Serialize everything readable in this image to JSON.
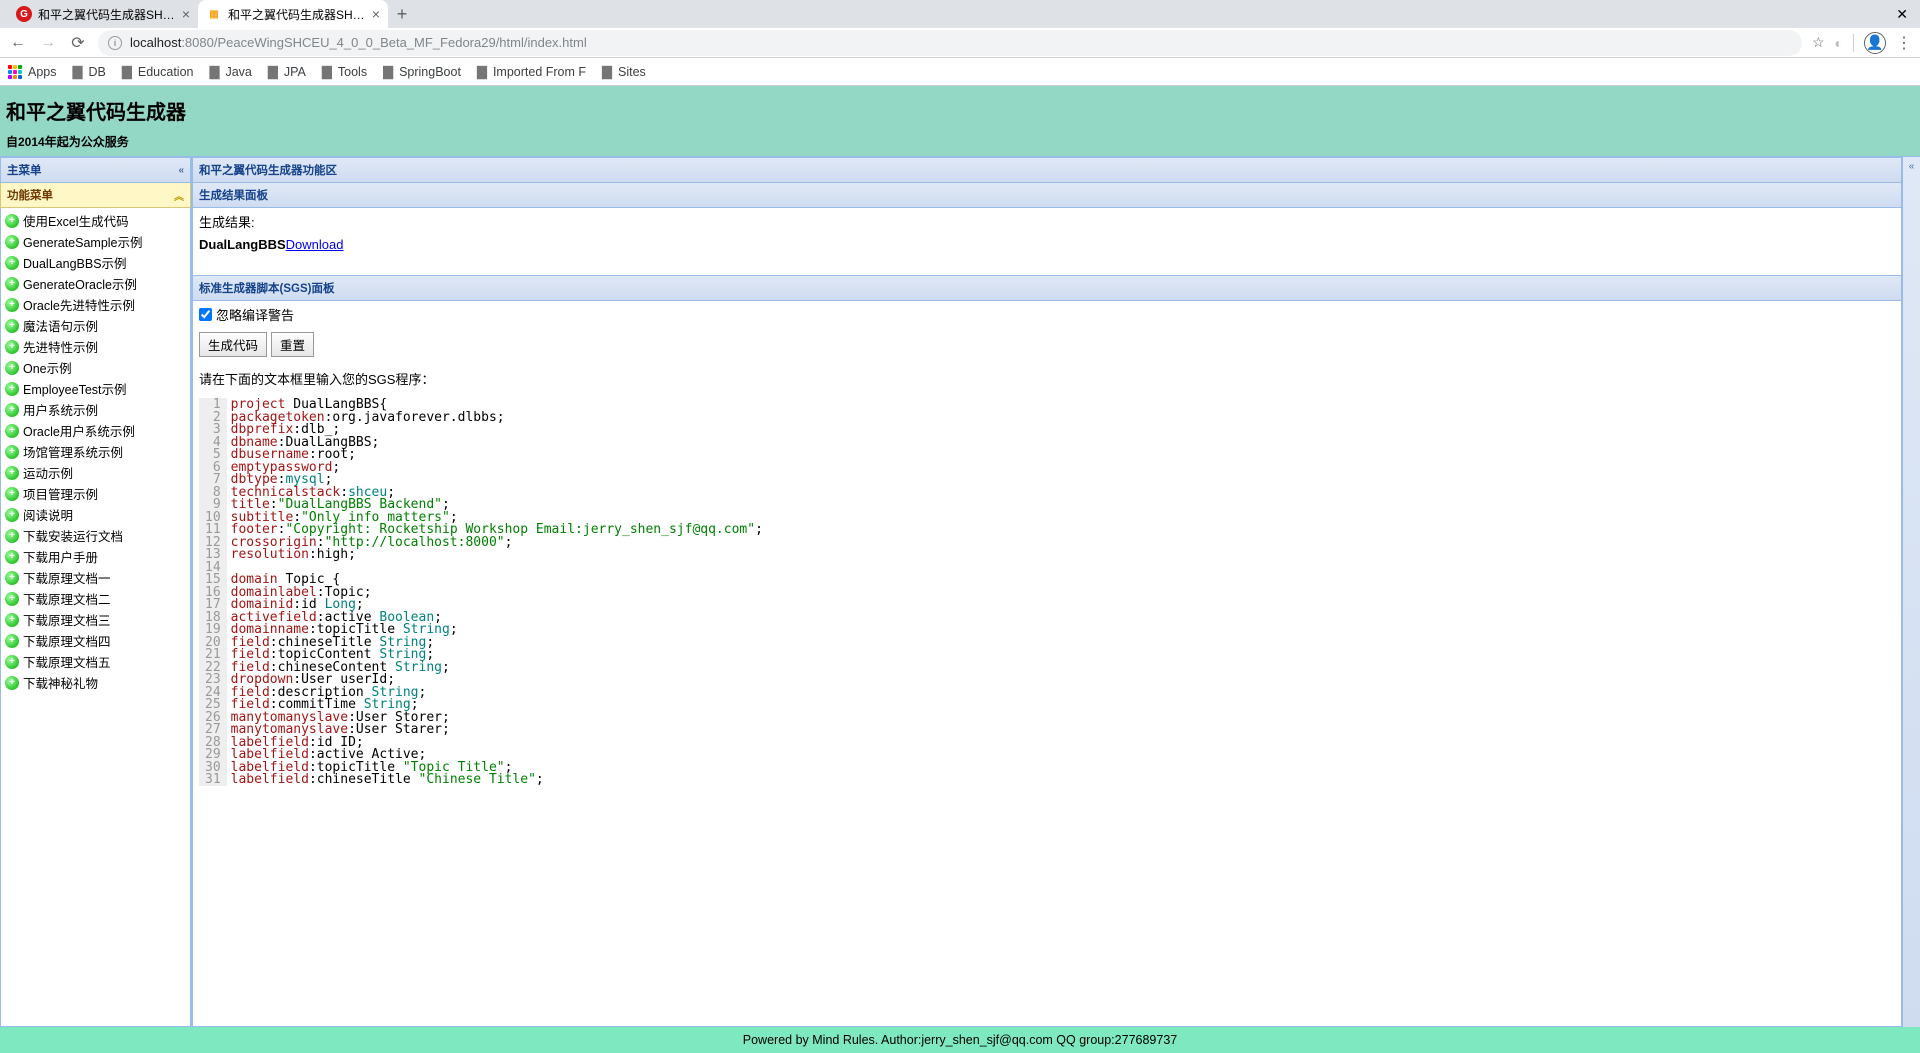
{
  "browser": {
    "tabs": [
      {
        "title": "和平之翼代码生成器SHCE...",
        "fav": {
          "text": "G",
          "bg": "#d7191c",
          "fg": "#fff"
        }
      },
      {
        "title": "和平之翼代码生成器SHCE...",
        "fav": {
          "text": "▦",
          "bg": "#fff",
          "fg": "#f5a623"
        }
      }
    ],
    "url_host": "localhost",
    "url_port": ":8080",
    "url_path": "/PeaceWingSHCEU_4_0_0_Beta_MF_Fedora29/html/index.html",
    "bookmarks": [
      "Apps",
      "DB",
      "Education",
      "Java",
      "JPA",
      "Tools",
      "SpringBoot",
      "Imported From F",
      "Sites"
    ]
  },
  "app": {
    "title": "和平之翼代码生成器",
    "subtitle": "自2014年起为公众服务",
    "footer": "Powered by Mind Rules. Author:jerry_shen_sjf@qq.com QQ group:277689737"
  },
  "left": {
    "main_menu": "主菜单",
    "fn_menu": "功能菜单",
    "items": [
      "使用Excel生成代码",
      "GenerateSample示例",
      "DualLangBBS示例",
      "GenerateOracle示例",
      "Oracle先进特性示例",
      "魔法语句示例",
      "先进特性示例",
      "One示例",
      "EmployeeTest示例",
      "用户系统示例",
      "Oracle用户系统示例",
      "场馆管理系统示例",
      "运动示例",
      "项目管理示例",
      "阅读说明",
      "下载安装运行文档",
      "下载用户手册",
      "下载原理文档一",
      "下载原理文档二",
      "下载原理文档三",
      "下载原理文档四",
      "下载原理文档五",
      "下载神秘礼物"
    ]
  },
  "center": {
    "region_title": "和平之翼代码生成器功能区",
    "result_panel": "生成结果面板",
    "result_label": "生成结果:",
    "result_name": "DualLangBBS",
    "result_link": "Download",
    "sgs_panel": "标准生成器脚本(SGS)面板",
    "chk_label": "忽略编译警告",
    "btn_gen": "生成代码",
    "btn_reset": "重置",
    "instruction": "请在下面的文本框里输入您的SGS程序："
  },
  "code": [
    [
      [
        "kw",
        "project"
      ],
      [
        "",
        " DualLangBBS{"
      ]
    ],
    [
      [
        "kw",
        "packagetoken"
      ],
      [
        "",
        ":org.javaforever.dlbbs;"
      ]
    ],
    [
      [
        "kw",
        "dbprefix"
      ],
      [
        "",
        ":dlb_;"
      ]
    ],
    [
      [
        "kw",
        "dbname"
      ],
      [
        "",
        ":DualLangBBS;"
      ]
    ],
    [
      [
        "kw",
        "dbusername"
      ],
      [
        "",
        ":root;"
      ]
    ],
    [
      [
        "kw",
        "emptypassword"
      ],
      [
        "",
        ";"
      ]
    ],
    [
      [
        "kw",
        "dbtype"
      ],
      [
        "",
        ":"
      ],
      [
        "ty",
        "mysql"
      ],
      [
        "",
        ";"
      ]
    ],
    [
      [
        "kw",
        "technicalstack"
      ],
      [
        "",
        ":"
      ],
      [
        "ty",
        "shceu"
      ],
      [
        "",
        ";"
      ]
    ],
    [
      [
        "kw",
        "title"
      ],
      [
        "",
        ":"
      ],
      [
        "st",
        "\"DualLangBBS Backend\""
      ],
      [
        "",
        ";"
      ]
    ],
    [
      [
        "kw",
        "subtitle"
      ],
      [
        "",
        ":"
      ],
      [
        "st",
        "\"Only info matters\""
      ],
      [
        "",
        ";"
      ]
    ],
    [
      [
        "kw",
        "footer"
      ],
      [
        "",
        ":"
      ],
      [
        "st",
        "\"Copyright: Rocketship Workshop Email:jerry_shen_sjf@qq.com\""
      ],
      [
        "",
        ";"
      ]
    ],
    [
      [
        "kw",
        "crossorigin"
      ],
      [
        "",
        ":"
      ],
      [
        "st",
        "\"http://localhost:8000\""
      ],
      [
        "",
        ";"
      ]
    ],
    [
      [
        "kw",
        "resolution"
      ],
      [
        "",
        ":high;"
      ]
    ],
    [
      [
        "",
        "  "
      ]
    ],
    [
      [
        "kw",
        "domain"
      ],
      [
        "",
        " Topic {"
      ]
    ],
    [
      [
        "kw",
        "domainlabel"
      ],
      [
        "",
        ":Topic;"
      ]
    ],
    [
      [
        "kw",
        "domainid"
      ],
      [
        "",
        ":id "
      ],
      [
        "ty",
        "Long"
      ],
      [
        "",
        ";"
      ]
    ],
    [
      [
        "kw",
        "activefield"
      ],
      [
        "",
        ":active "
      ],
      [
        "ty",
        "Boolean"
      ],
      [
        "",
        ";"
      ]
    ],
    [
      [
        "kw",
        "domainname"
      ],
      [
        "",
        ":topicTitle "
      ],
      [
        "ty",
        "String"
      ],
      [
        "",
        ";"
      ]
    ],
    [
      [
        "kw",
        "field"
      ],
      [
        "",
        ":chineseTitle "
      ],
      [
        "ty",
        "String"
      ],
      [
        "",
        ";"
      ]
    ],
    [
      [
        "kw",
        "field"
      ],
      [
        "",
        ":topicContent "
      ],
      [
        "ty",
        "String"
      ],
      [
        "",
        ";"
      ]
    ],
    [
      [
        "kw",
        "field"
      ],
      [
        "",
        ":chineseContent "
      ],
      [
        "ty",
        "String"
      ],
      [
        "",
        ";"
      ]
    ],
    [
      [
        "kw",
        "dropdown"
      ],
      [
        "",
        ":User userId;"
      ]
    ],
    [
      [
        "kw",
        "field"
      ],
      [
        "",
        ":description "
      ],
      [
        "ty",
        "String"
      ],
      [
        "",
        ";"
      ]
    ],
    [
      [
        "kw",
        "field"
      ],
      [
        "",
        ":commitTime "
      ],
      [
        "ty",
        "String"
      ],
      [
        "",
        ";"
      ]
    ],
    [
      [
        "kw",
        "manytomanyslave"
      ],
      [
        "",
        ":User Storer;"
      ]
    ],
    [
      [
        "kw",
        "manytomanyslave"
      ],
      [
        "",
        ":User Starer;"
      ]
    ],
    [
      [
        "kw",
        "labelfield"
      ],
      [
        "",
        ":id ID;"
      ]
    ],
    [
      [
        "kw",
        "labelfield"
      ],
      [
        "",
        ":active Active;"
      ]
    ],
    [
      [
        "kw",
        "labelfield"
      ],
      [
        "",
        ":topicTitle "
      ],
      [
        "st",
        "\"Topic Title\""
      ],
      [
        "",
        ";"
      ]
    ],
    [
      [
        "kw",
        "labelfield"
      ],
      [
        "",
        ":chineseTitle "
      ],
      [
        "st",
        "\"Chinese Title\""
      ],
      [
        "",
        ";"
      ]
    ]
  ]
}
